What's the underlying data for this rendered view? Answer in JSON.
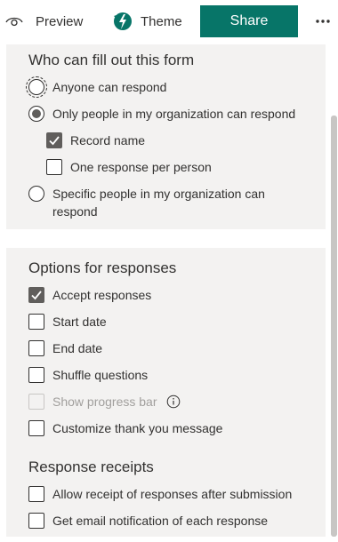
{
  "topbar": {
    "preview_label": "Preview",
    "theme_label": "Theme",
    "share_label": "Share",
    "more_icon": "more-horizontal-icon",
    "accent_color": "#077568"
  },
  "fill_section": {
    "heading": "Who can fill out this form",
    "options": [
      {
        "label": "Anyone can respond",
        "type": "radio",
        "checked": false,
        "focused": true
      },
      {
        "label": "Only people in my organization can respond",
        "type": "radio",
        "checked": true
      },
      {
        "label": "Record name",
        "type": "checkbox",
        "checked": true
      },
      {
        "label": "One response per person",
        "type": "checkbox",
        "checked": false
      },
      {
        "label_line1": "Specific people in my organization can",
        "label_line2": "respond",
        "type": "radio",
        "checked": false
      }
    ]
  },
  "responses_section": {
    "heading": "Options for responses",
    "options": [
      {
        "label": "Accept responses",
        "checked": true
      },
      {
        "label": "Start date",
        "checked": false
      },
      {
        "label": "End date",
        "checked": false
      },
      {
        "label": "Shuffle questions",
        "checked": false
      },
      {
        "label": "Show progress bar",
        "checked": false,
        "disabled": true
      },
      {
        "label": "Customize thank you message",
        "checked": false
      }
    ]
  },
  "receipts_section": {
    "heading": "Response receipts",
    "options": [
      {
        "label": "Allow receipt of responses after submission",
        "checked": false
      },
      {
        "label": "Get email notification of each response",
        "checked": false
      }
    ]
  }
}
